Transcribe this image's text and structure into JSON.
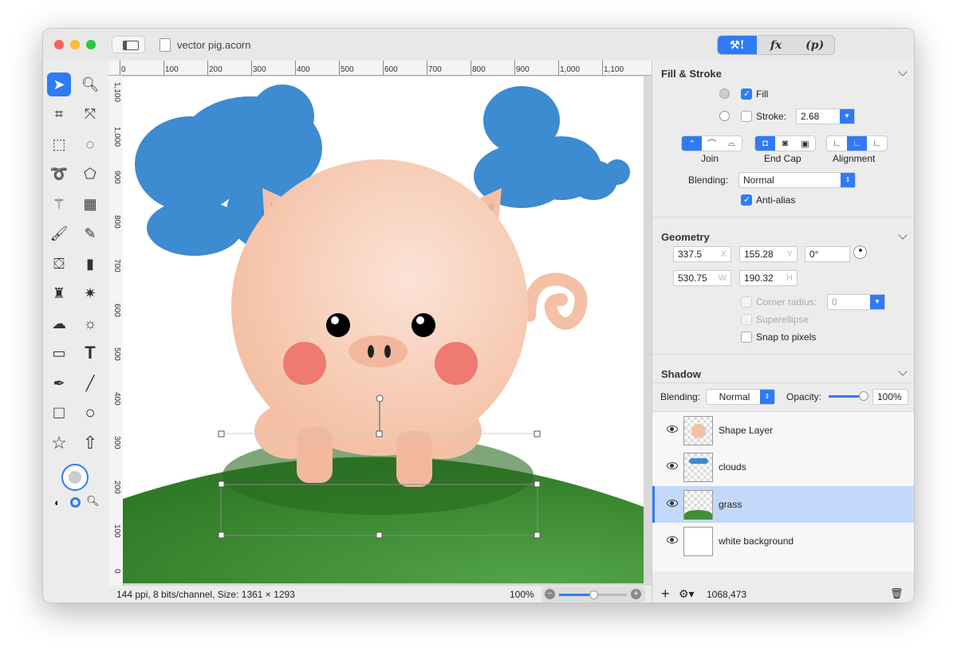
{
  "window": {
    "title": "vector pig.acorn",
    "inspector_tabs": [
      "tools-icon",
      "fx",
      "(p)"
    ]
  },
  "ruler": {
    "top": [
      "0",
      "100",
      "200",
      "300",
      "400",
      "500",
      "600",
      "700",
      "800",
      "900",
      "1,000",
      "1,100"
    ],
    "left": [
      "1,100",
      "1,000",
      "900",
      "800",
      "700",
      "600",
      "500",
      "400",
      "300",
      "200",
      "100",
      "0"
    ]
  },
  "status": {
    "info": "144 ppi, 8 bits/channel, Size: 1361 × 1293",
    "zoom": "100%"
  },
  "fill_stroke": {
    "title": "Fill & Stroke",
    "fill_label": "Fill",
    "fill_checked": true,
    "stroke_label": "Stroke:",
    "stroke_checked": false,
    "stroke_width": "2.68",
    "join_label": "Join",
    "endcap_label": "End Cap",
    "alignment_label": "Alignment",
    "blending_label": "Blending:",
    "blending": "Normal",
    "antialias_label": "Anti-alias",
    "antialias_checked": true
  },
  "geometry": {
    "title": "Geometry",
    "x": "337.5",
    "x_unit": "X",
    "y": "155.28",
    "y_unit": "Y",
    "angle": "0°",
    "w": "530.75",
    "w_unit": "W",
    "h": "190.32",
    "h_unit": "H",
    "corner_radius_label": "Corner radius:",
    "corner_radius": "0",
    "superellipse_label": "Superellipse",
    "snap_label": "Snap to pixels"
  },
  "shadow": {
    "title": "Shadow",
    "blending_label": "Blending:",
    "blending": "Normal",
    "opacity_label": "Opacity:",
    "opacity": "100%",
    "opacity_fraction": 1.0
  },
  "layers": [
    {
      "name": "Shape Layer",
      "selected": false
    },
    {
      "name": "clouds",
      "selected": false
    },
    {
      "name": "grass",
      "selected": true
    },
    {
      "name": "white background",
      "selected": false
    }
  ],
  "layers_footer": {
    "coords": "1068,473"
  },
  "colors": {
    "accent": "#2f7bf5",
    "cloud": "#3d8bd0",
    "grass": "#3f8f35",
    "pig": "#f6c7b0"
  }
}
